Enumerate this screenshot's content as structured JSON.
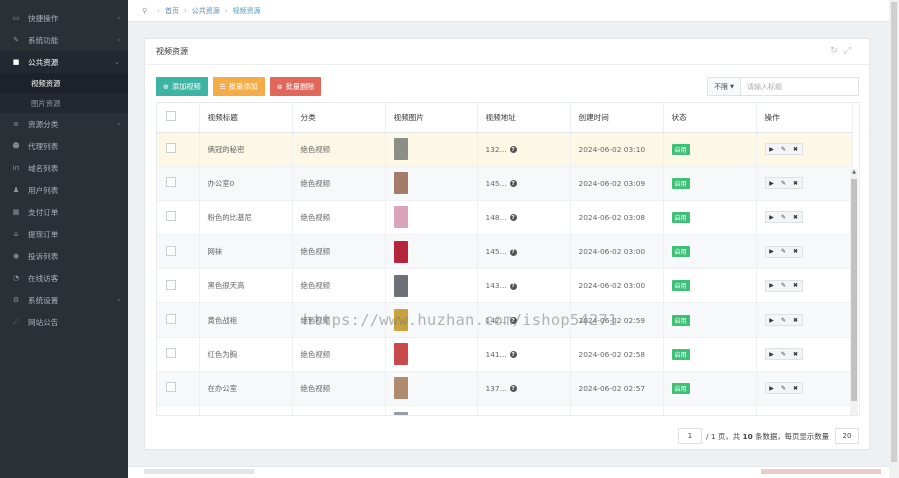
{
  "sidebar": {
    "items": [
      {
        "icon": "folder-open-icon",
        "glyph": "▭",
        "label": "快捷操作",
        "chevron": true
      },
      {
        "icon": "wrench-icon",
        "glyph": "✎",
        "label": "系统功能",
        "chevron": true
      },
      {
        "icon": "video-camera-icon",
        "glyph": "■",
        "label": "公共资源",
        "chevron": true,
        "active": true
      },
      {
        "icon": "list-icon",
        "glyph": "≡",
        "label": "资源分类",
        "chevron": true
      },
      {
        "icon": "users-icon",
        "glyph": "☻",
        "label": "代理列表",
        "chevron": false
      },
      {
        "icon": "linkedin-icon",
        "glyph": "in",
        "label": "域名列表",
        "chevron": false
      },
      {
        "icon": "user-icon",
        "glyph": "♟",
        "label": "用户列表",
        "chevron": false
      },
      {
        "icon": "calendar-icon",
        "glyph": "▦",
        "label": "支付订单",
        "chevron": false
      },
      {
        "icon": "bank-icon",
        "glyph": "⌂",
        "label": "提现订单",
        "chevron": false
      },
      {
        "icon": "circle-icon",
        "glyph": "◉",
        "label": "投诉列表",
        "chevron": false
      },
      {
        "icon": "chat-icon",
        "glyph": "◔",
        "label": "在线访客",
        "chevron": false
      },
      {
        "icon": "gear-icon",
        "glyph": "⚙",
        "label": "系统设置",
        "chevron": true
      },
      {
        "icon": "broadcast-icon",
        "glyph": "☄",
        "label": "网站公告",
        "chevron": false
      }
    ],
    "subitems": [
      {
        "label": "视频资源",
        "active": true
      },
      {
        "label": "图片资源",
        "active": false
      }
    ]
  },
  "breadcrumb": {
    "home": "首页",
    "parent": "公共资源",
    "current": "视频资源"
  },
  "panel": {
    "title": "视频资源",
    "buttons": {
      "add": "添加视频",
      "batch_add": "批量添加",
      "batch_delete": "批量删除"
    },
    "filter": {
      "select_value": "不限",
      "placeholder": "请输入标题"
    }
  },
  "table": {
    "headers": [
      "视频标题",
      "分类",
      "视频图片",
      "视频地址",
      "创建时间",
      "状态",
      "操作"
    ],
    "rows": [
      {
        "title": "俩冠的秘密",
        "category": "绝色视频",
        "url": "132...",
        "created": "2024-06-02 03:10",
        "status": "启用",
        "thumb": "#8c8f87"
      },
      {
        "title": "办公室0",
        "category": "绝色视频",
        "url": "145...",
        "created": "2024-06-02 03:09",
        "status": "启用",
        "thumb": "#a37d6a"
      },
      {
        "title": "粉色的比基尼",
        "category": "绝色视频",
        "url": "148...",
        "created": "2024-06-02 03:08",
        "status": "启用",
        "thumb": "#d9a4b8"
      },
      {
        "title": "网袜",
        "category": "绝色视频",
        "url": "145...",
        "created": "2024-06-02 03:00",
        "status": "启用",
        "thumb": "#b4243a"
      },
      {
        "title": "黑色很天高",
        "category": "绝色视频",
        "url": "143...",
        "created": "2024-06-02 03:00",
        "status": "启用",
        "thumb": "#6e7078"
      },
      {
        "title": "黄色战袍",
        "category": "绝色视频",
        "url": "142...",
        "created": "2024-06-02 02:59",
        "status": "启用",
        "thumb": "#c9a23e"
      },
      {
        "title": "红色为胸",
        "category": "绝色视频",
        "url": "141...",
        "created": "2024-06-02 02:58",
        "status": "启用",
        "thumb": "#c94a4c"
      },
      {
        "title": "在办公室",
        "category": "绝色视频",
        "url": "137...",
        "created": "2024-06-02 02:57",
        "status": "启用",
        "thumb": "#b08a6c"
      },
      {
        "title": "",
        "category": "",
        "url": "",
        "created": "",
        "status": "",
        "thumb": "#9a9da3"
      }
    ],
    "ops": [
      "▶",
      "✎",
      "✖"
    ]
  },
  "pagination": {
    "current_page": "1",
    "prefix": "/ 1 页，共 ",
    "total": "10",
    "suffix": " 条数据，每页显示数量",
    "page_size": "20"
  },
  "watermark": "https://www.huzhan.com/ishop54271",
  "colors": {
    "sidebar_bg": "#2b3037",
    "teal": "#3cb4a3",
    "orange": "#f4ac49",
    "red": "#e0675a",
    "badge_green": "#3fbf78"
  }
}
